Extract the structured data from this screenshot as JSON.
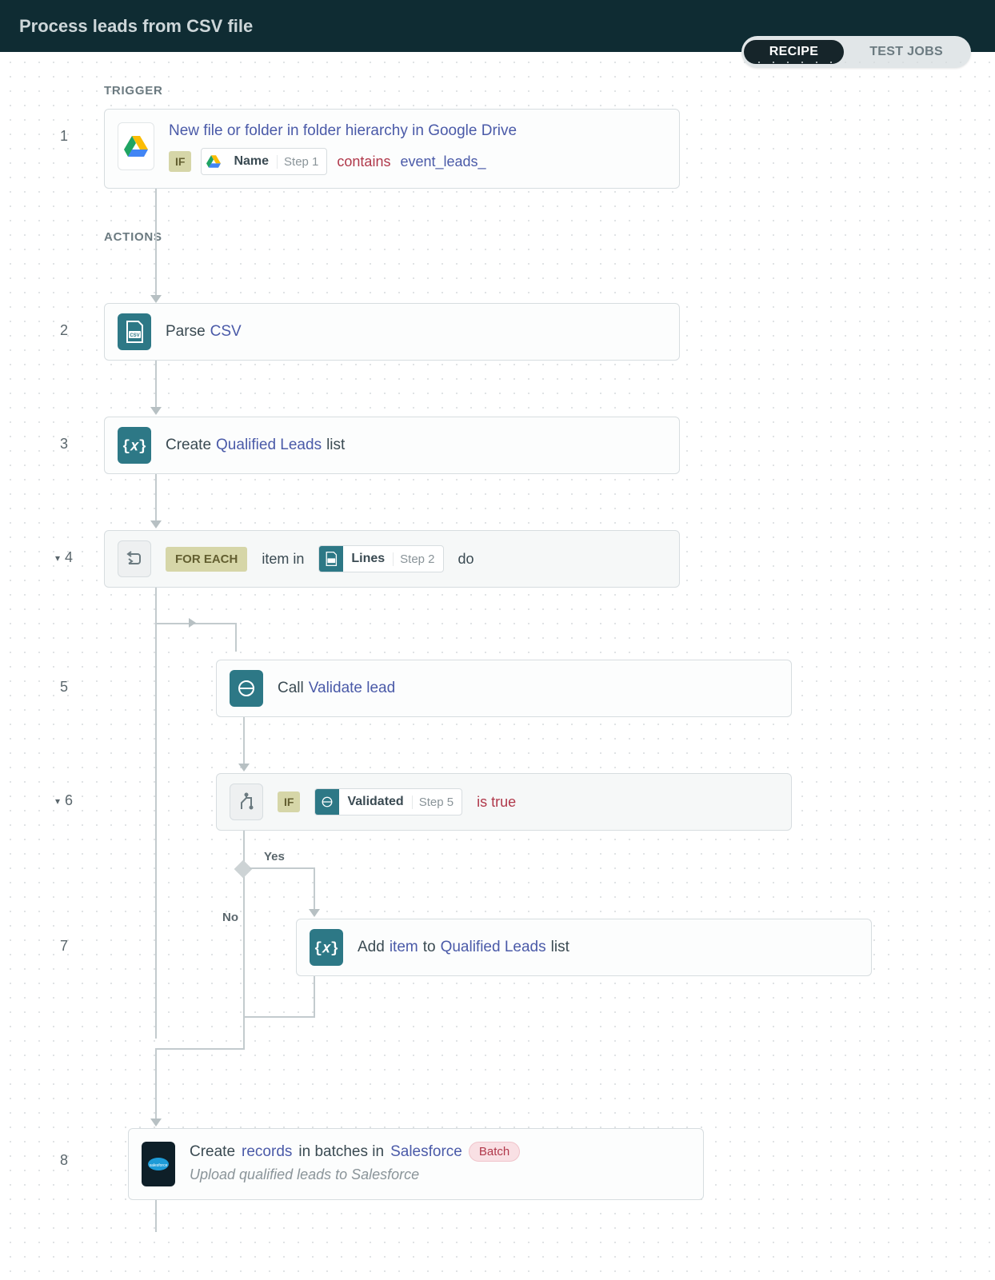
{
  "header": {
    "title": "Process leads from CSV file"
  },
  "tabs": {
    "recipe": "RECIPE",
    "testjobs": "TEST JOBS"
  },
  "sections": {
    "trigger": "TRIGGER",
    "actions": "ACTIONS"
  },
  "steps": {
    "n1": "1",
    "n2": "2",
    "n3": "3",
    "n4": "4",
    "n5": "5",
    "n6": "6",
    "n7": "7",
    "n8": "8"
  },
  "step1": {
    "title": "New file or folder in folder hierarchy in Google Drive",
    "if": "IF",
    "pill_label": "Name",
    "pill_step": "Step 1",
    "kw_contains": "contains",
    "kw_value": "event_leads_"
  },
  "step2": {
    "prefix": "Parse ",
    "link": "CSV"
  },
  "step3": {
    "prefix": "Create ",
    "link": "Qualified Leads",
    "suffix": " list"
  },
  "step4": {
    "foreach": "FOR EACH",
    "item_in": "item in",
    "pill_label": "Lines",
    "pill_step": "Step 2",
    "do": "do"
  },
  "step5": {
    "prefix": "Call ",
    "link": "Validate lead"
  },
  "step6": {
    "if": "IF",
    "pill_label": "Validated",
    "pill_step": "Step 5",
    "kw": "is true",
    "yes": "Yes",
    "no": "No"
  },
  "step7": {
    "w1": "Add ",
    "l1": "item",
    "w2": " to ",
    "l2": "Qualified Leads",
    "w3": " list"
  },
  "step8": {
    "w1": "Create ",
    "l1": "records",
    "w2": " in batches in ",
    "l2": "Salesforce",
    "batch": "Batch",
    "subtitle": "Upload qualified leads to Salesforce"
  }
}
